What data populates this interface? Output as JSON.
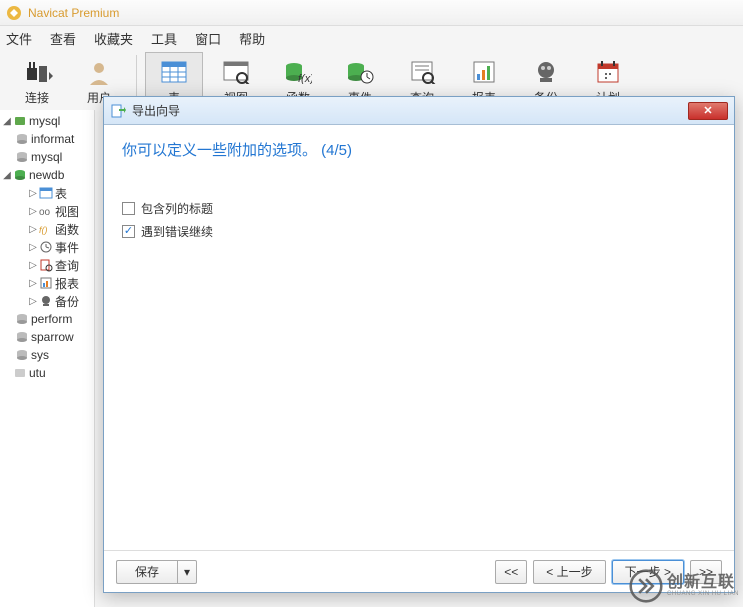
{
  "app": {
    "title": "Navicat Premium"
  },
  "menu": {
    "items": [
      "文件",
      "查看",
      "收藏夹",
      "工具",
      "窗口",
      "帮助"
    ]
  },
  "toolbar": {
    "items": [
      {
        "label": "连接",
        "icon": "connection"
      },
      {
        "label": "用户",
        "icon": "user"
      },
      {
        "label": "表",
        "icon": "table",
        "active": true
      },
      {
        "label": "视图",
        "icon": "view"
      },
      {
        "label": "函数",
        "icon": "function"
      },
      {
        "label": "事件",
        "icon": "event"
      },
      {
        "label": "查询",
        "icon": "query"
      },
      {
        "label": "报表",
        "icon": "report"
      },
      {
        "label": "备份",
        "icon": "backup"
      },
      {
        "label": "计划",
        "icon": "schedule"
      }
    ]
  },
  "tree": {
    "root": {
      "label": "mysql"
    },
    "items": [
      {
        "label": "informat",
        "type": "db",
        "indent": 1
      },
      {
        "label": "mysql",
        "type": "db",
        "indent": 1
      },
      {
        "label": "newdb",
        "type": "dbopen",
        "indent": 1,
        "expand": true
      },
      {
        "label": "表",
        "type": "table",
        "indent": 2,
        "expand": false
      },
      {
        "label": "视图",
        "type": "view",
        "indent": 2,
        "expand": false
      },
      {
        "label": "函数",
        "type": "func",
        "indent": 2,
        "expand": false
      },
      {
        "label": "事件",
        "type": "event",
        "indent": 2,
        "expand": false
      },
      {
        "label": "查询",
        "type": "query",
        "indent": 2,
        "expand": false
      },
      {
        "label": "报表",
        "type": "report",
        "indent": 2,
        "expand": false
      },
      {
        "label": "备份",
        "type": "backup",
        "indent": 2,
        "expand": false
      },
      {
        "label": "perform",
        "type": "db",
        "indent": 1
      },
      {
        "label": "sparrow",
        "type": "db",
        "indent": 1
      },
      {
        "label": "sys",
        "type": "db",
        "indent": 1
      },
      {
        "label": "utu",
        "type": "server",
        "indent": 0
      }
    ]
  },
  "dialog": {
    "title": "导出向导",
    "heading": "你可以定义一些附加的选项。 (4/5)",
    "checks": [
      {
        "label": "包含列的标题",
        "checked": false
      },
      {
        "label": "遇到错误继续",
        "checked": true
      }
    ],
    "footer": {
      "save": "保存",
      "dropdown": "▾",
      "first": "<<",
      "prev": "< 上一步",
      "next": "下一步 >",
      "last": ">>"
    }
  },
  "watermark": {
    "main": "创新互联",
    "sub": "CHUANG XIN HU LIAN"
  }
}
